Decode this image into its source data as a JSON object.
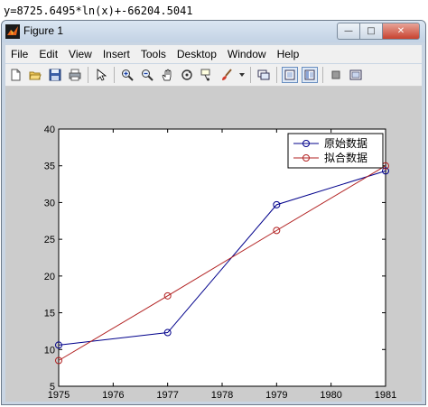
{
  "console_text": "y=8725.6495*ln(x)+-66204.5041",
  "window": {
    "title": "Figure 1",
    "buttons": {
      "minimize": "—",
      "maximize": "□",
      "close": "✕"
    }
  },
  "menu": [
    "File",
    "Edit",
    "View",
    "Insert",
    "Tools",
    "Desktop",
    "Window",
    "Help"
  ],
  "toolbar_icons": [
    "new-figure-icon",
    "open-file-icon",
    "save-icon",
    "print-icon",
    "|",
    "edit-plot-arrow-icon",
    "|",
    "zoom-in-icon",
    "zoom-out-icon",
    "pan-hand-icon",
    "rotate-3d-icon",
    "data-cursor-icon",
    "brush-icon",
    "dropdown-arrow-icon",
    "|",
    "link-plot-icon",
    "|",
    "hide-plot-tools-icon",
    "show-plot-tools-icon",
    "|",
    "colorbar-icon",
    "legend-icon"
  ],
  "colors": {
    "series_original": "#00008b",
    "series_fit": "#b22222",
    "figure_background": "#cccccc"
  },
  "chart_data": {
    "type": "line",
    "xlim": [
      1975,
      1981
    ],
    "ylim": [
      5,
      40
    ],
    "xticks": [
      "1975",
      "1976",
      "1977",
      "1978",
      "1979",
      "1980",
      "1981"
    ],
    "yticks": [
      "5",
      "10",
      "15",
      "20",
      "25",
      "30",
      "35",
      "40"
    ],
    "grid": false,
    "legend_position": "top-right",
    "series": [
      {
        "name": "原始数据",
        "color": "#00008b",
        "marker": "circle",
        "x": [
          1975,
          1977,
          1979,
          1981
        ],
        "y": [
          10.6,
          12.3,
          29.7,
          34.3
        ]
      },
      {
        "name": "拟合数据",
        "color": "#b22222",
        "marker": "circle",
        "x": [
          1975,
          1977,
          1979,
          1981
        ],
        "y": [
          8.5,
          17.3,
          26.2,
          35.0
        ]
      }
    ]
  }
}
